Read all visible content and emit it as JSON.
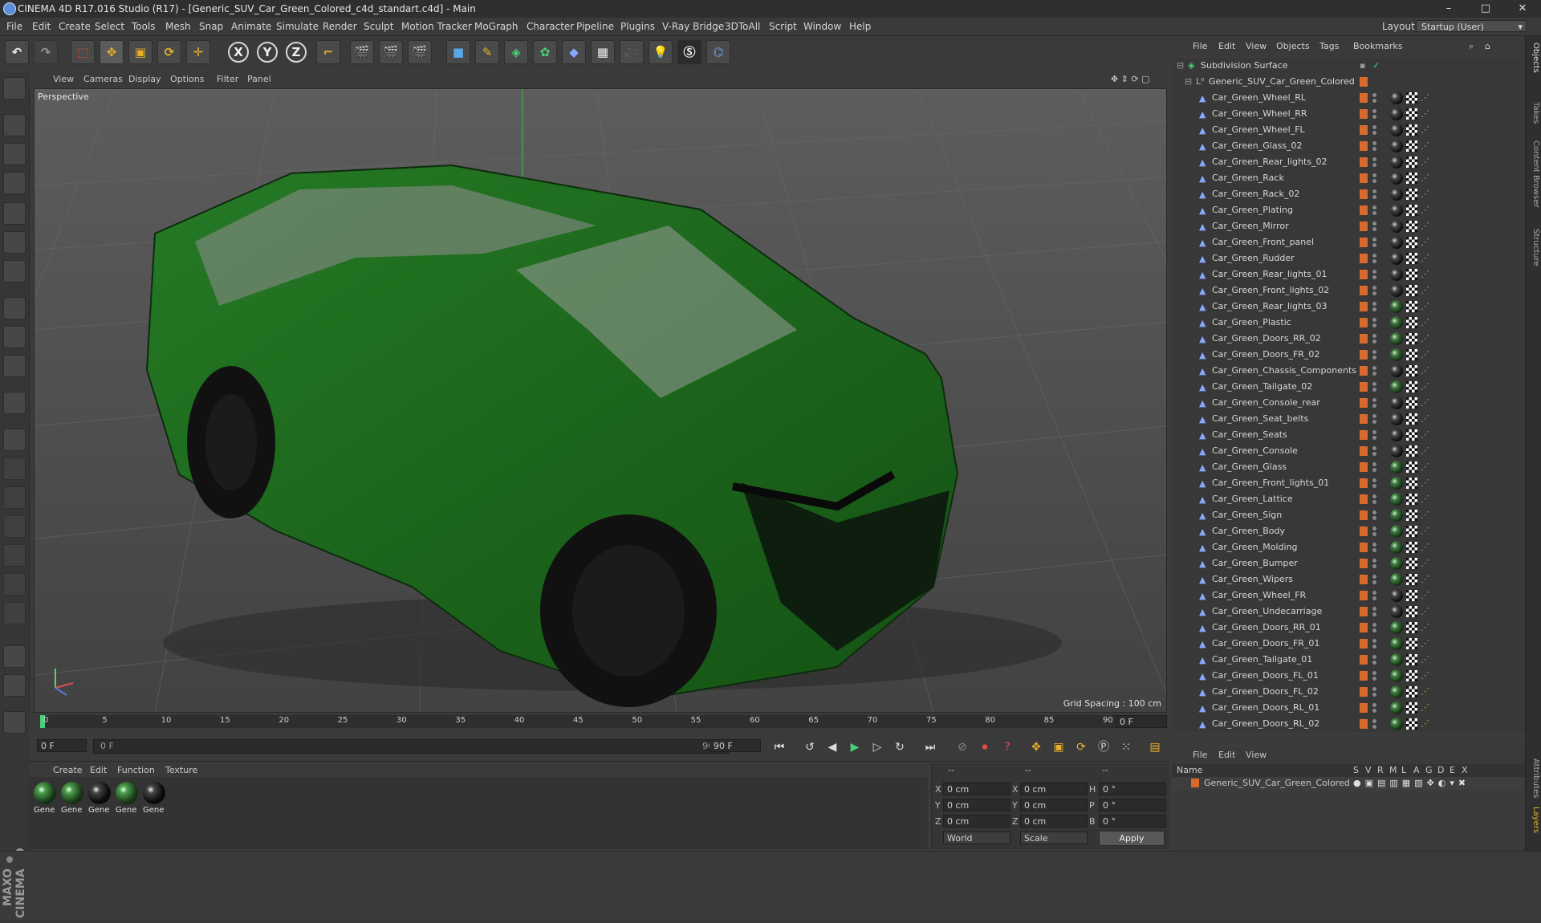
{
  "window": {
    "title": "CINEMA 4D R17.016 Studio (R17) - [Generic_SUV_Car_Green_Colored_c4d_standart.c4d] - Main",
    "controls": [
      "–",
      "□",
      "✕"
    ]
  },
  "menubar": {
    "items": [
      "File",
      "Edit",
      "Create",
      "Select",
      "Tools",
      "Mesh",
      "Snap",
      "Animate",
      "Simulate",
      "Render",
      "Sculpt",
      "Motion Tracker",
      "MoGraph",
      "Character",
      "Pipeline",
      "Plugins",
      "V-Ray Bridge",
      "3DToAll",
      "Script",
      "Window",
      "Help"
    ],
    "layout_label": "Layout:",
    "layout_value": "Startup (User)"
  },
  "toolbar": {
    "axis_buttons": [
      "X",
      "Y",
      "Z"
    ]
  },
  "viewport": {
    "menu": [
      "View",
      "Cameras",
      "Display",
      "Options",
      "Filter",
      "Panel"
    ],
    "camera_label": "Perspective",
    "grid_spacing": "Grid Spacing : 100 cm"
  },
  "timeline": {
    "ticks": [
      "0",
      "5",
      "10",
      "15",
      "20",
      "25",
      "30",
      "35",
      "40",
      "45",
      "50",
      "55",
      "60",
      "65",
      "70",
      "75",
      "80",
      "85",
      "90"
    ],
    "current_frame_right": "0 F",
    "start_field": "0 F",
    "slider_start": "0 F",
    "slider_end": "90 F",
    "end_field": "90 F"
  },
  "material_manager": {
    "menu": [
      "Create",
      "Edit",
      "Function",
      "Texture"
    ],
    "materials": [
      "Gene",
      "Gene",
      "Gene",
      "Gene",
      "Gene"
    ]
  },
  "coordinates": {
    "header": [
      "--",
      "--",
      "--"
    ],
    "rows": [
      {
        "axis": "X",
        "pos": "0 cm",
        "axis2": "X",
        "size": "0 cm",
        "axis3": "H",
        "rot": "0 °"
      },
      {
        "axis": "Y",
        "pos": "0 cm",
        "axis2": "Y",
        "size": "0 cm",
        "axis3": "P",
        "rot": "0 °"
      },
      {
        "axis": "Z",
        "pos": "0 cm",
        "axis2": "Z",
        "size": "0 cm",
        "axis3": "B",
        "rot": "0 °"
      }
    ],
    "mode1": "World",
    "mode2": "Scale",
    "apply": "Apply"
  },
  "object_manager": {
    "menu": [
      "File",
      "Edit",
      "View",
      "Objects",
      "Tags",
      "Bookmarks"
    ],
    "root": "Subdivision Surface",
    "group": "Generic_SUV_Car_Green_Colored",
    "objects": [
      {
        "name": "Car_Green_Wheel_RL",
        "mat": "black"
      },
      {
        "name": "Car_Green_Wheel_RR",
        "mat": "black"
      },
      {
        "name": "Car_Green_Wheel_FL",
        "mat": "black"
      },
      {
        "name": "Car_Green_Glass_02",
        "mat": "black"
      },
      {
        "name": "Car_Green_Rear_lights_02",
        "mat": "black"
      },
      {
        "name": "Car_Green_Rack",
        "mat": "black"
      },
      {
        "name": "Car_Green_Rack_02",
        "mat": "black"
      },
      {
        "name": "Car_Green_Plating",
        "mat": "black"
      },
      {
        "name": "Car_Green_Mirror",
        "mat": "black"
      },
      {
        "name": "Car_Green_Front_panel",
        "mat": "black"
      },
      {
        "name": "Car_Green_Rudder",
        "mat": "black"
      },
      {
        "name": "Car_Green_Rear_lights_01",
        "mat": "black"
      },
      {
        "name": "Car_Green_Front_lights_02",
        "mat": "black"
      },
      {
        "name": "Car_Green_Rear_lights_03",
        "mat": "green"
      },
      {
        "name": "Car_Green_Plastic",
        "mat": "green"
      },
      {
        "name": "Car_Green_Doors_RR_02",
        "mat": "green"
      },
      {
        "name": "Car_Green_Doors_FR_02",
        "mat": "green"
      },
      {
        "name": "Car_Green_Chassis_Components",
        "mat": "black"
      },
      {
        "name": "Car_Green_Tailgate_02",
        "mat": "green"
      },
      {
        "name": "Car_Green_Console_rear",
        "mat": "black"
      },
      {
        "name": "Car_Green_Seat_belts",
        "mat": "black"
      },
      {
        "name": "Car_Green_Seats",
        "mat": "black"
      },
      {
        "name": "Car_Green_Console",
        "mat": "black"
      },
      {
        "name": "Car_Green_Glass",
        "mat": "green"
      },
      {
        "name": "Car_Green_Front_lights_01",
        "mat": "green"
      },
      {
        "name": "Car_Green_Lattice",
        "mat": "green"
      },
      {
        "name": "Car_Green_Sign",
        "mat": "green"
      },
      {
        "name": "Car_Green_Body",
        "mat": "green"
      },
      {
        "name": "Car_Green_Molding",
        "mat": "green"
      },
      {
        "name": "Car_Green_Bumper",
        "mat": "green"
      },
      {
        "name": "Car_Green_Wipers",
        "mat": "green"
      },
      {
        "name": "Car_Green_Wheel_FR",
        "mat": "black"
      },
      {
        "name": "Car_Green_Undecarriage",
        "mat": "black"
      },
      {
        "name": "Car_Green_Doors_RR_01",
        "mat": "green"
      },
      {
        "name": "Car_Green_Doors_FR_01",
        "mat": "green"
      },
      {
        "name": "Car_Green_Tailgate_01",
        "mat": "green"
      },
      {
        "name": "Car_Green_Doors_FL_01",
        "mat": "green"
      },
      {
        "name": "Car_Green_Doors_FL_02",
        "mat": "green"
      },
      {
        "name": "Car_Green_Doors_RL_01",
        "mat": "green"
      },
      {
        "name": "Car_Green_Doors_RL_02",
        "mat": "green"
      }
    ]
  },
  "layer_manager": {
    "menu": [
      "File",
      "Edit",
      "View"
    ],
    "name_col": "Name",
    "cols": [
      "S",
      "V",
      "R",
      "M",
      "L",
      "A",
      "G",
      "D",
      "E",
      "X"
    ],
    "row": "Generic_SUV_Car_Green_Colored"
  },
  "side_tabs": [
    "Objects",
    "Takes",
    "Content Browser",
    "Structure",
    "Attributes",
    "Layers"
  ],
  "brand": "MAXON CINEMA 4D",
  "colors": {
    "car_body": "#1e6b1e",
    "accent_orange": "#d96a2e",
    "viewport_bg": "#4d4d4d"
  }
}
